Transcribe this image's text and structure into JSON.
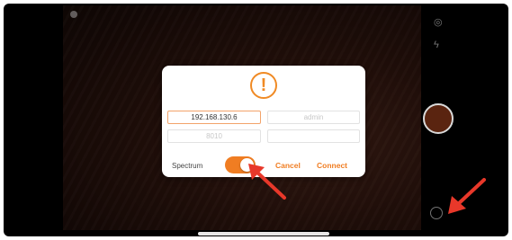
{
  "dialog": {
    "ip_value": "192.168.130.6",
    "username_value": "admin",
    "port_value": "8010",
    "password_value": "",
    "spectrum_label": "Spectrum",
    "spectrum_on": true,
    "cancel_label": "Cancel",
    "connect_label": "Connect"
  },
  "colors": {
    "accent": "#f07d22",
    "annotation_arrow": "#e8382a"
  },
  "icons": {
    "alert": "exclamation-circle-icon",
    "flash": "lightning-icon",
    "settings": "gear-icon"
  }
}
